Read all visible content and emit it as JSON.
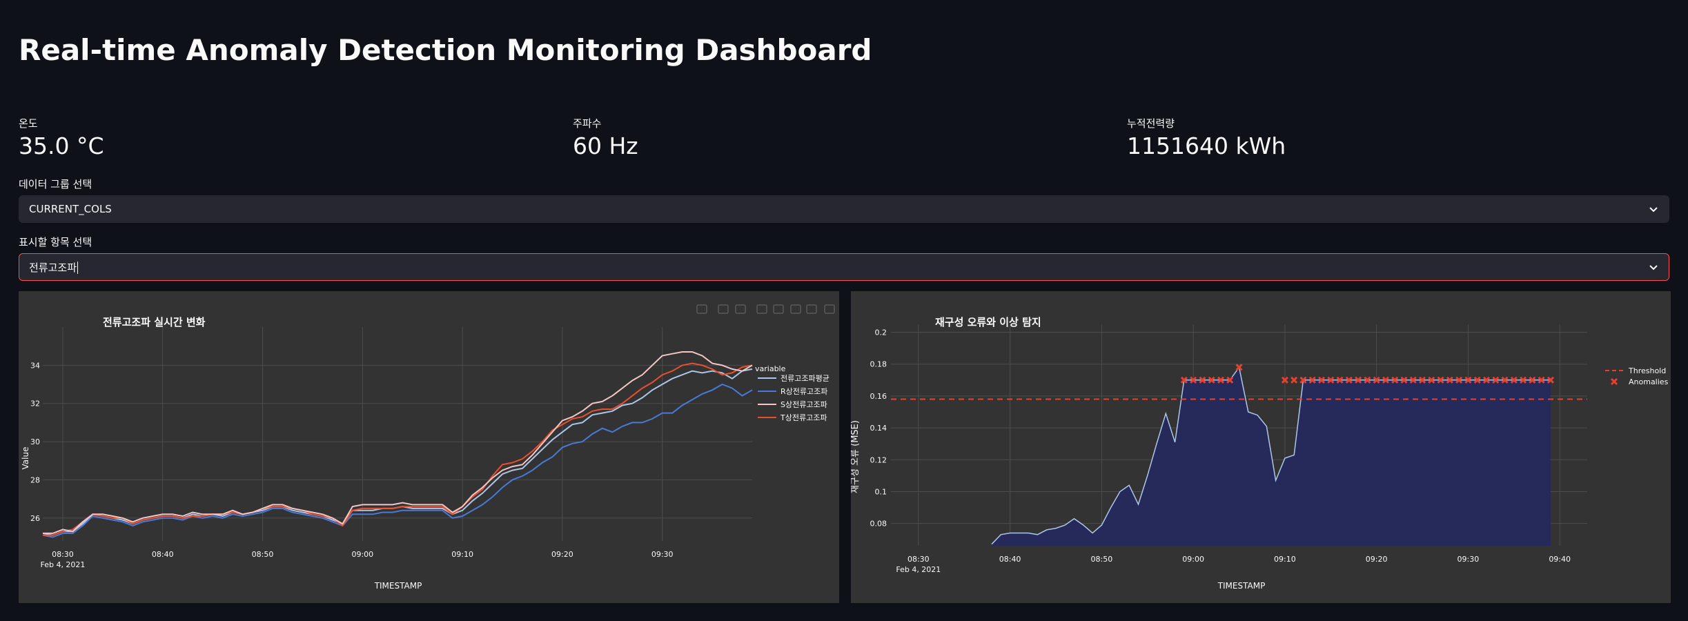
{
  "page": {
    "title": "Real-time Anomaly Detection Monitoring Dashboard"
  },
  "metrics": [
    {
      "label": "온도",
      "value": "35.0 °C"
    },
    {
      "label": "주파수",
      "value": "60 Hz"
    },
    {
      "label": "누적전력량",
      "value": "1151640 kWh"
    }
  ],
  "group_select": {
    "label": "데이터 그룹 선택",
    "value": "CURRENT_COLS"
  },
  "item_select": {
    "label": "표시할 항목 선택",
    "value": "전류고조파"
  },
  "colors": {
    "background": "#0e1117",
    "panel": "#333333",
    "focus_border": "#ff4b4b",
    "series_avg": "#aec7e8",
    "series_r": "#4a7ad8",
    "series_s": "#f4c6c6",
    "series_t": "#e8502e",
    "mse_line": "#aec7e8",
    "mse_fill": "#252a5a",
    "threshold": "#e8402e",
    "anomaly": "#e8402e"
  },
  "toolbar_icons": [
    "camera-icon",
    "zoom-icon",
    "pan-icon",
    "zoom-in-icon",
    "zoom-out-icon",
    "autoscale-icon",
    "reset-axes-icon",
    "fullscreen-icon"
  ],
  "chart_data": [
    {
      "type": "line",
      "title": "전류고조파 실시간 변화",
      "xlabel": "TIMESTAMP",
      "ylabel": "Value",
      "x_tick_labels": [
        "08:30",
        "08:40",
        "08:50",
        "09:00",
        "09:10",
        "09:20",
        "09:30"
      ],
      "x_tick_values": [
        0,
        10,
        20,
        30,
        40,
        50,
        60
      ],
      "x_date_label": "Feb 4, 2021",
      "xlim": [
        -2,
        69
      ],
      "y_ticks": [
        26,
        28,
        30,
        32,
        34
      ],
      "ylim": [
        24.8,
        36
      ],
      "grid": true,
      "legend_title": "variable",
      "legend_position": "right",
      "x": [
        -2,
        -1,
        0,
        1,
        2,
        3,
        4,
        5,
        6,
        7,
        8,
        9,
        10,
        11,
        12,
        13,
        14,
        15,
        16,
        17,
        18,
        19,
        20,
        21,
        22,
        23,
        24,
        25,
        26,
        27,
        28,
        29,
        30,
        31,
        32,
        33,
        34,
        35,
        36,
        37,
        38,
        39,
        40,
        41,
        42,
        43,
        44,
        45,
        46,
        47,
        48,
        49,
        50,
        51,
        52,
        53,
        54,
        55,
        56,
        57,
        58,
        59,
        60,
        61,
        62,
        63,
        64,
        65,
        66,
        67,
        68,
        69
      ],
      "series": [
        {
          "name": "전류고조파평균",
          "values": [
            25.2,
            25.1,
            25.3,
            25.3,
            25.7,
            26.2,
            26.1,
            26.0,
            25.9,
            25.7,
            25.9,
            26.0,
            26.1,
            26.1,
            26.0,
            26.2,
            26.1,
            26.2,
            26.1,
            26.3,
            26.2,
            26.3,
            26.4,
            26.6,
            26.6,
            26.4,
            26.3,
            26.2,
            26.1,
            25.9,
            25.7,
            26.4,
            26.4,
            26.4,
            26.5,
            26.5,
            26.6,
            26.5,
            26.5,
            26.5,
            26.5,
            26.2,
            26.4,
            26.9,
            27.3,
            27.8,
            28.3,
            28.5,
            28.6,
            29.1,
            29.6,
            30.1,
            30.5,
            30.9,
            31.0,
            31.4,
            31.5,
            31.6,
            31.9,
            32.0,
            32.3,
            32.7,
            33.0,
            33.3,
            33.5,
            33.7,
            33.6,
            33.7,
            33.6,
            33.3,
            33.7,
            33.8
          ]
        },
        {
          "name": "R상전류고조파",
          "values": [
            25.1,
            25.0,
            25.2,
            25.2,
            25.6,
            26.1,
            26.0,
            25.9,
            25.8,
            25.6,
            25.8,
            25.9,
            26.0,
            26.0,
            25.9,
            26.1,
            26.0,
            26.1,
            26.0,
            26.2,
            26.1,
            26.2,
            26.3,
            26.5,
            26.5,
            26.3,
            26.2,
            26.1,
            26.0,
            25.8,
            25.6,
            26.2,
            26.2,
            26.2,
            26.3,
            26.3,
            26.4,
            26.4,
            26.4,
            26.4,
            26.4,
            26.0,
            26.1,
            26.4,
            26.7,
            27.1,
            27.6,
            28.0,
            28.2,
            28.5,
            28.9,
            29.2,
            29.7,
            29.9,
            30.0,
            30.4,
            30.7,
            30.5,
            30.8,
            31.0,
            31.0,
            31.2,
            31.5,
            31.5,
            31.9,
            32.2,
            32.5,
            32.7,
            33.0,
            32.8,
            32.4,
            32.7
          ]
        },
        {
          "name": "S상전류고조파",
          "values": [
            25.2,
            25.2,
            25.4,
            25.3,
            25.8,
            26.2,
            26.2,
            26.1,
            26.0,
            25.8,
            26.0,
            26.1,
            26.2,
            26.2,
            26.1,
            26.3,
            26.2,
            26.2,
            26.2,
            26.4,
            26.2,
            26.3,
            26.5,
            26.7,
            26.7,
            26.5,
            26.4,
            26.3,
            26.2,
            26.0,
            25.7,
            26.6,
            26.7,
            26.7,
            26.7,
            26.7,
            26.8,
            26.7,
            26.7,
            26.7,
            26.7,
            26.3,
            26.6,
            27.2,
            27.6,
            28.1,
            28.5,
            28.7,
            28.8,
            29.3,
            29.9,
            30.5,
            31.1,
            31.3,
            31.6,
            32.0,
            32.1,
            32.4,
            32.8,
            33.2,
            33.5,
            34.0,
            34.5,
            34.6,
            34.7,
            34.7,
            34.5,
            34.1,
            34.0,
            33.8,
            33.7,
            34.0
          ]
        },
        {
          "name": "T상전류고조파",
          "values": [
            25.1,
            25.1,
            25.3,
            25.4,
            25.8,
            26.2,
            26.1,
            26.0,
            26.0,
            25.7,
            25.9,
            26.0,
            26.1,
            26.1,
            26.0,
            26.1,
            26.1,
            26.2,
            26.2,
            26.3,
            26.2,
            26.3,
            26.5,
            26.6,
            26.6,
            26.5,
            26.4,
            26.2,
            26.1,
            26.0,
            25.6,
            26.4,
            26.5,
            26.5,
            26.5,
            26.5,
            26.6,
            26.6,
            26.6,
            26.6,
            26.6,
            26.2,
            26.6,
            27.1,
            27.5,
            28.2,
            28.8,
            28.9,
            29.1,
            29.5,
            30.0,
            30.6,
            30.9,
            31.2,
            31.3,
            31.6,
            31.7,
            31.7,
            32.0,
            32.4,
            32.8,
            33.1,
            33.5,
            33.7,
            34.0,
            34.1,
            34.0,
            33.8,
            33.5,
            33.6,
            33.9,
            34.0
          ]
        }
      ]
    },
    {
      "type": "area",
      "title": "재구성 오류와 이상 탐지",
      "xlabel": "TIMESTAMP",
      "ylabel": "재구성 오류 (MSE)",
      "x_tick_labels": [
        "08:30",
        "08:40",
        "08:50",
        "09:00",
        "09:10",
        "09:20",
        "09:30",
        "09:40"
      ],
      "x_tick_values": [
        0,
        10,
        20,
        30,
        40,
        50,
        60,
        70
      ],
      "x_date_label": "Feb 4, 2021",
      "xlim": [
        -3,
        73
      ],
      "y_ticks": [
        0.08,
        0.1,
        0.12,
        0.14,
        0.16,
        0.18,
        0.2
      ],
      "y_tick_labels": [
        "0.08",
        "0.1",
        "0.12",
        "0.14",
        "0.16",
        "0.18",
        "0.2"
      ],
      "ylim": [
        0.066,
        0.205
      ],
      "grid": true,
      "legend_position": "top-right",
      "threshold": {
        "name": "Threshold",
        "value": 0.158
      },
      "x": [
        8,
        9,
        10,
        11,
        12,
        13,
        14,
        15,
        16,
        17,
        18,
        19,
        20,
        21,
        22,
        23,
        24,
        25,
        26,
        27,
        28,
        29,
        30,
        31,
        32,
        33,
        34,
        35,
        36,
        37,
        38,
        39,
        40,
        41,
        42,
        43,
        44,
        45,
        46,
        47,
        48,
        49,
        50,
        51,
        52,
        53,
        54,
        55,
        56,
        57,
        58,
        59,
        60,
        61,
        62,
        63,
        64,
        65,
        66,
        67,
        68,
        69
      ],
      "values": [
        0.067,
        0.073,
        0.074,
        0.074,
        0.074,
        0.073,
        0.076,
        0.077,
        0.079,
        0.083,
        0.079,
        0.074,
        0.079,
        0.09,
        0.1,
        0.104,
        0.092,
        0.11,
        0.13,
        0.149,
        0.131,
        0.17,
        0.17,
        0.17,
        0.17,
        0.17,
        0.17,
        0.178,
        0.15,
        0.148,
        0.141,
        0.107,
        0.121,
        0.123,
        0.17,
        0.17,
        0.17,
        0.17,
        0.17,
        0.17,
        0.17,
        0.17,
        0.17,
        0.17,
        0.17,
        0.17,
        0.17,
        0.17,
        0.17,
        0.17,
        0.17,
        0.17,
        0.17,
        0.17,
        0.17,
        0.17,
        0.17,
        0.17,
        0.17,
        0.17,
        0.17,
        0.17
      ],
      "anomalies": {
        "name": "Anomalies",
        "x": [
          29,
          30,
          31,
          32,
          33,
          34,
          35,
          40,
          41,
          42,
          43,
          44,
          45,
          46,
          47,
          48,
          49,
          50,
          51,
          52,
          53,
          54,
          55,
          56,
          57,
          58,
          59,
          60,
          61,
          62,
          63,
          64,
          65,
          66,
          67,
          68,
          69
        ],
        "values": [
          0.17,
          0.17,
          0.17,
          0.17,
          0.17,
          0.17,
          0.178,
          0.17,
          0.17,
          0.17,
          0.17,
          0.17,
          0.17,
          0.17,
          0.17,
          0.17,
          0.17,
          0.17,
          0.17,
          0.17,
          0.17,
          0.17,
          0.17,
          0.17,
          0.17,
          0.17,
          0.17,
          0.17,
          0.17,
          0.17,
          0.17,
          0.17,
          0.17,
          0.17,
          0.17,
          0.17,
          0.17
        ]
      }
    }
  ]
}
